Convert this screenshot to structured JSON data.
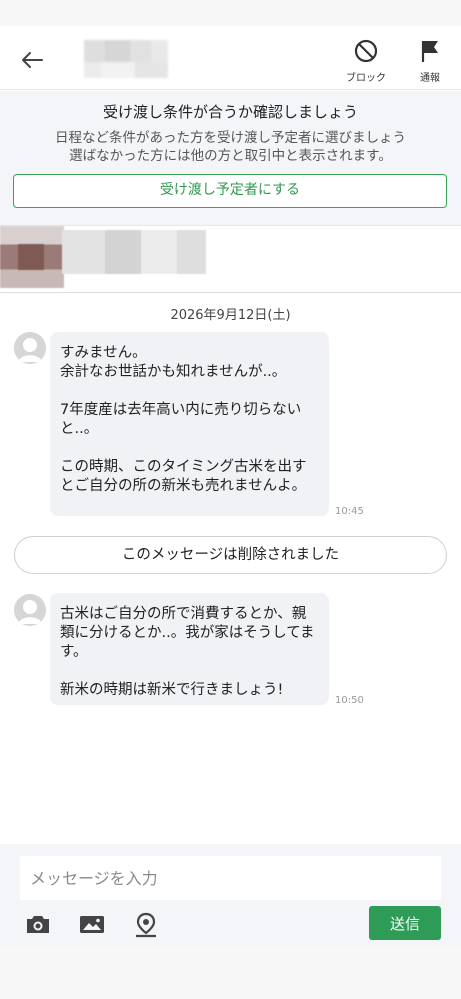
{
  "header": {
    "back_icon": "back-arrow-icon",
    "block_label": "ブロック",
    "report_label": "通報"
  },
  "banner": {
    "title": "受け渡し条件が合うか確認しましょう",
    "desc_line1": "日程など条件があった方を受け渡し予定者に選びましょう",
    "desc_line2": "選ばなかった方には他の方と取引中と表示されます。",
    "button": "受け渡し予定者にする"
  },
  "chat": {
    "date": "2026年9月12日(土)",
    "messages": [
      {
        "text": "すみません。\n余計なお世話かも知れませんが..。\n\n7年度産は去年高い内に売り切らないと..。\n\nこの時期、このタイミング古米を出すとご自分の所の新米も売れませんよ。",
        "time": "10:45"
      },
      {
        "text": "古米はご自分の所で消費するとか、親類に分けるとか..。我が家はそうしてます。\n\n新米の時期は新米で行きましょう!",
        "time": "10:50"
      }
    ],
    "system": "このメッセージは削除されました"
  },
  "composer": {
    "placeholder": "メッセージを入力",
    "send_label": "送信",
    "icons": [
      "camera-icon",
      "image-icon",
      "location-icon"
    ]
  },
  "colors": {
    "accent": "#2e9b57",
    "banner_bg": "#f4f5f9",
    "bubble_bg": "#f1f2f6"
  }
}
